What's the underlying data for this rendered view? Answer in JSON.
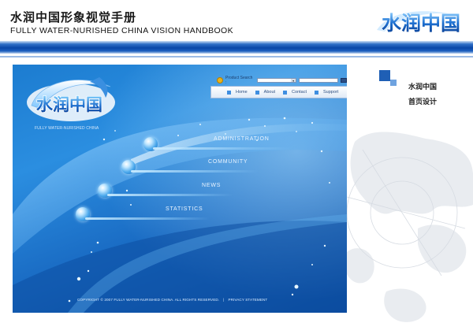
{
  "handbook": {
    "title_cn": "水润中国形象视觉手册",
    "title_en": "FULLY WATER-NURISHED CHINA VISION HANDBOOK",
    "logo_text": "水润中国"
  },
  "side": {
    "label_1": "水润中国",
    "label_2": "首页设计"
  },
  "site": {
    "logo_text": "水润中国",
    "tagline": "FULLY WATER-NURISHED CHINA",
    "search": {
      "label": "Product Search :",
      "select_value": "",
      "input_value": ""
    },
    "nav": [
      {
        "label": "Home"
      },
      {
        "label": "About"
      },
      {
        "label": "Contact"
      },
      {
        "label": "Support"
      }
    ],
    "menu": [
      {
        "label": "ADMINISTRATION"
      },
      {
        "label": "COMMUNITY"
      },
      {
        "label": "NEWS"
      },
      {
        "label": "STATISTICS"
      }
    ],
    "footer": {
      "copyright": "COPYRIGHT © 2007 FULLY WATER-NURISHED CHINA. ALL RIGHTS RESERVED.",
      "separator": "|",
      "privacy": "PRIVACY STATEMENT"
    }
  },
  "colors": {
    "brand_blue": "#0a47a8",
    "page_blue": "#1c7cd0",
    "accent_light": "#6fa3e0"
  }
}
